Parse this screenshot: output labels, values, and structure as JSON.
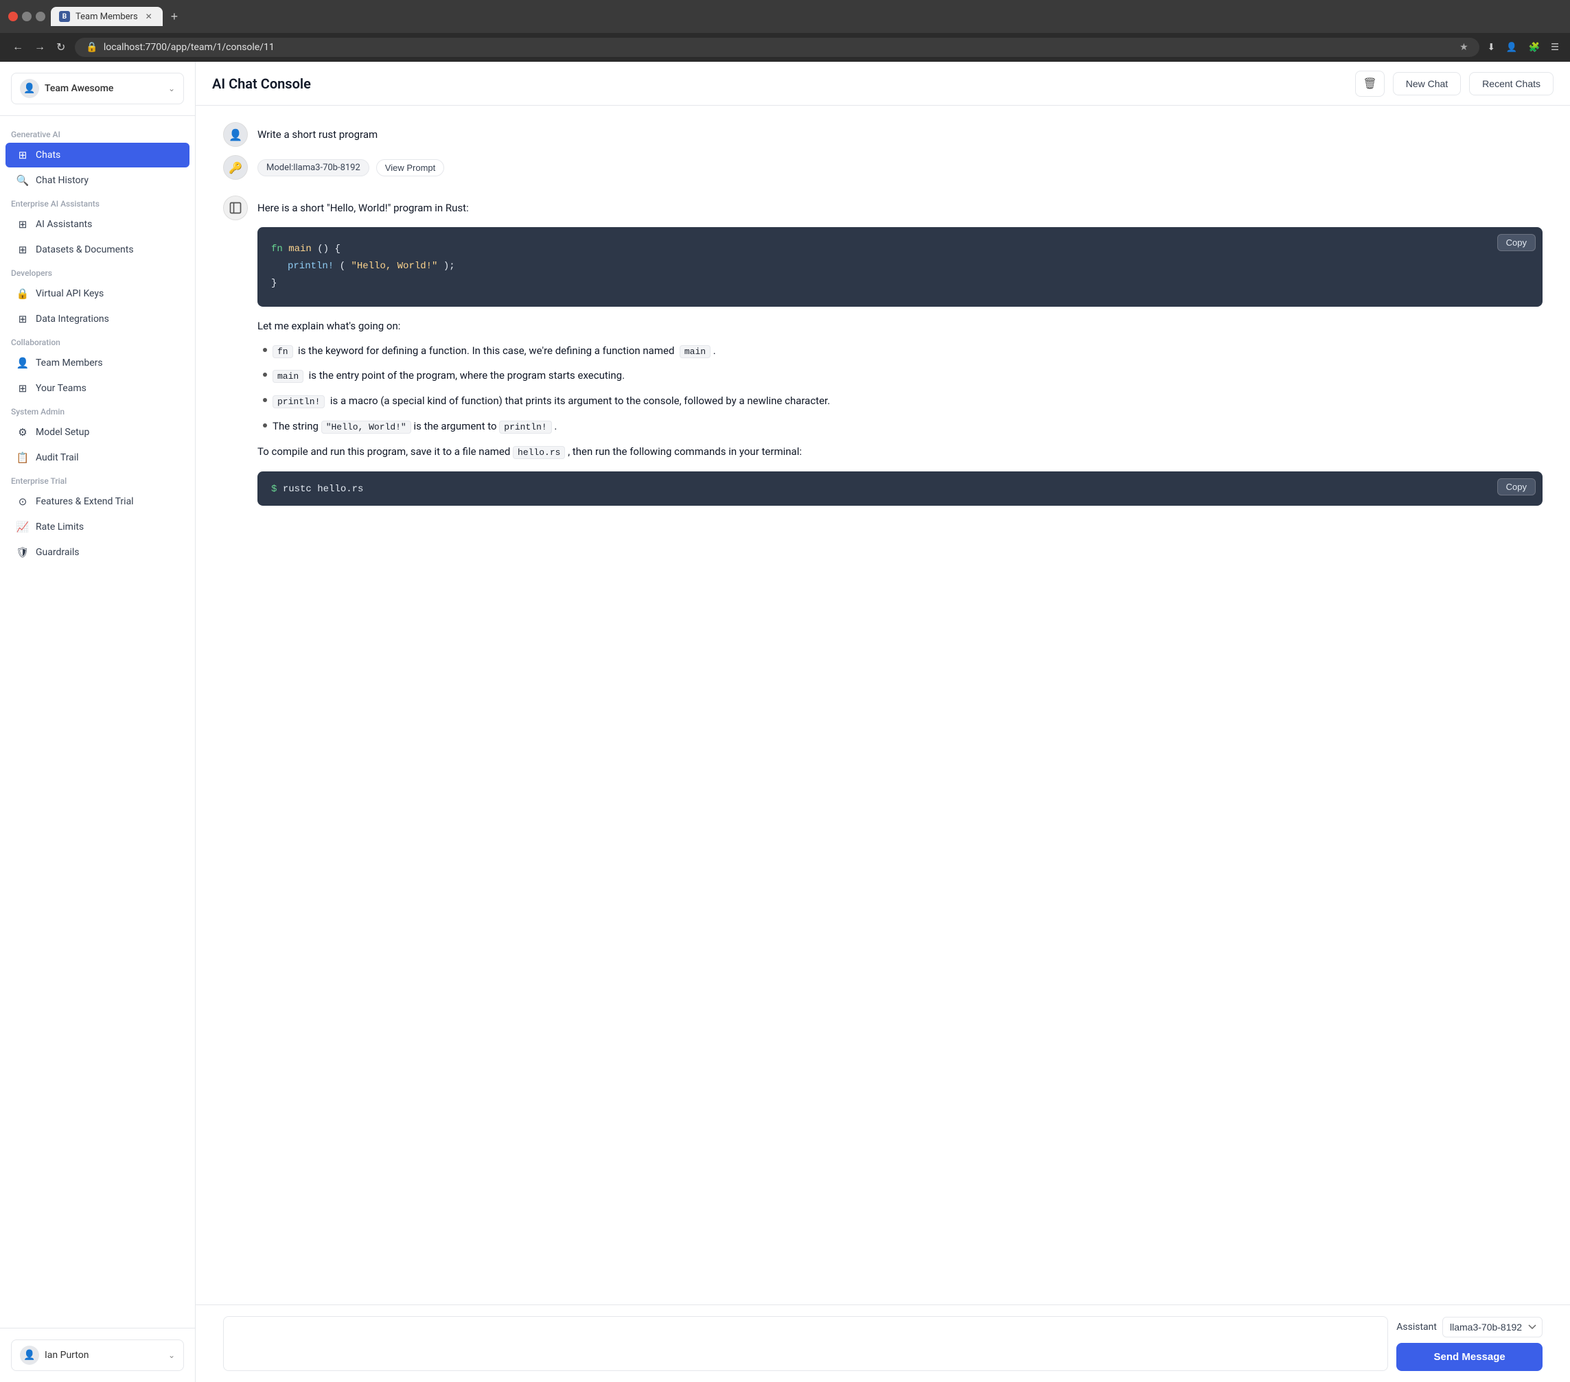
{
  "browser": {
    "tab_label": "Team Members",
    "tab_icon": "B",
    "url": "localhost:7700/app/team/1/console/11",
    "new_tab_label": "+"
  },
  "sidebar": {
    "team_name": "Team Awesome",
    "sections": [
      {
        "label": "Generative AI",
        "items": [
          {
            "id": "chats",
            "label": "Chats",
            "icon": "⊞",
            "active": true
          },
          {
            "id": "chat-history",
            "label": "Chat History",
            "icon": "🔍"
          }
        ]
      },
      {
        "label": "Enterprise AI Assistants",
        "items": [
          {
            "id": "ai-assistants",
            "label": "AI Assistants",
            "icon": "⊞"
          },
          {
            "id": "datasets-documents",
            "label": "Datasets & Documents",
            "icon": "⊞"
          }
        ]
      },
      {
        "label": "Developers",
        "items": [
          {
            "id": "virtual-api-keys",
            "label": "Virtual API Keys",
            "icon": "🔒"
          },
          {
            "id": "data-integrations",
            "label": "Data Integrations",
            "icon": "⊞"
          }
        ]
      },
      {
        "label": "Collaboration",
        "items": [
          {
            "id": "team-members",
            "label": "Team Members",
            "icon": "👤"
          },
          {
            "id": "your-teams",
            "label": "Your Teams",
            "icon": "⊞"
          }
        ]
      },
      {
        "label": "System Admin",
        "items": [
          {
            "id": "model-setup",
            "label": "Model Setup",
            "icon": "⚙"
          },
          {
            "id": "audit-trail",
            "label": "Audit Trail",
            "icon": "📋"
          }
        ]
      },
      {
        "label": "Enterprise Trial",
        "items": [
          {
            "id": "features-extend-trial",
            "label": "Features & Extend Trial",
            "icon": "⊙"
          },
          {
            "id": "rate-limits",
            "label": "Rate Limits",
            "icon": "📈"
          },
          {
            "id": "guardrails",
            "label": "Guardrails",
            "icon": "🛡"
          }
        ]
      }
    ],
    "user_name": "Ian Purton"
  },
  "header": {
    "title": "AI Chat Console",
    "new_chat_label": "New Chat",
    "recent_chats_label": "Recent Chats"
  },
  "chat": {
    "user_message": "Write a short rust program",
    "model_badge": "Model:llama3-70b-8192",
    "view_prompt_label": "View Prompt",
    "ai_intro": "Here is a short \"Hello, World!\" program in Rust:",
    "code_copy": "Copy",
    "code_lines": [
      "fn main() {",
      "    println!(\"Hello, World!\");",
      "}"
    ],
    "explanation_intro": "Let me explain what's going on:",
    "bullets": [
      {
        "keyword": "fn",
        "text": " is the keyword for defining a function. In this case, we're defining a function named ",
        "keyword2": "main",
        "text2": "."
      },
      {
        "keyword": "main",
        "text": " is the entry point of the program, where the program starts executing."
      },
      {
        "keyword": "println!",
        "text": " is a macro (a special kind of function) that prints its argument to the console, followed by a newline character."
      },
      {
        "prefix": "The string ",
        "keyword": "\"Hello, World!\"",
        "text": " is the argument to ",
        "keyword2": "println!",
        "text2": "."
      }
    ],
    "compile_text": "To compile and run this program, save it to a file named ",
    "compile_filename": "hello.rs",
    "compile_text2": ", then run the following commands in your terminal:",
    "terminal_prompt": "$ ",
    "terminal_cmd": "rustc hello.rs",
    "terminal_copy": "Copy"
  },
  "input": {
    "placeholder": "",
    "assistant_label": "Assistant",
    "assistant_options": [
      "llama3-70b-8192"
    ],
    "assistant_selected": "llama3-70b-8192",
    "send_label": "Send Message"
  }
}
